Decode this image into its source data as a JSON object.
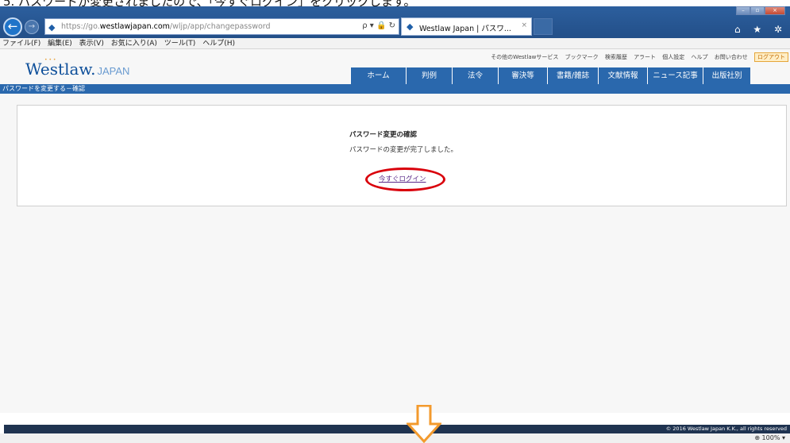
{
  "caption": "5. パスワードが変更されましたので、「今すぐログイン」をクリックします。",
  "browser": {
    "url_host": "https://go.",
    "url_domain": "westlawjapan.com",
    "url_path": "/wljp/app/changepassword",
    "address_controls": "ρ ▾ 🔒 ↻",
    "tab_title": "Westlaw Japan | パスワ...",
    "tab_close": "×",
    "toolbar_icons": "⌂ ★ ✲"
  },
  "menubar": [
    "ファイル(F)",
    "編集(E)",
    "表示(V)",
    "お気に入り(A)",
    "ツール(T)",
    "ヘルプ(H)"
  ],
  "header": {
    "logo_text": "Westlaw.",
    "logo_sub": "JAPAN",
    "util_links": [
      "その他のWestlawサービス",
      "ブックマーク",
      "検索履歴",
      "アラート",
      "個人設定",
      "ヘルプ",
      "お問い合わせ"
    ],
    "logout_label": "ログアウト",
    "nav": [
      "ホーム",
      "判例",
      "法令",
      "審決等",
      "書籍/雑誌",
      "文献情報",
      "ニュース記事",
      "出版社別"
    ],
    "breadcrumb": "パスワードを変更する－確認"
  },
  "panel": {
    "heading": "パスワード変更の確認",
    "message": "パスワードの変更が完了しました。",
    "login_link": "今すぐログイン"
  },
  "footer": {
    "copyright": "© 2016 Westlaw Japan K.K., all rights reserved",
    "zoom": "⊕ 100% ▾"
  },
  "colors": {
    "brand_blue": "#2a68ad",
    "highlight_ring": "#d9000b",
    "arrow": "#f39a2d"
  }
}
